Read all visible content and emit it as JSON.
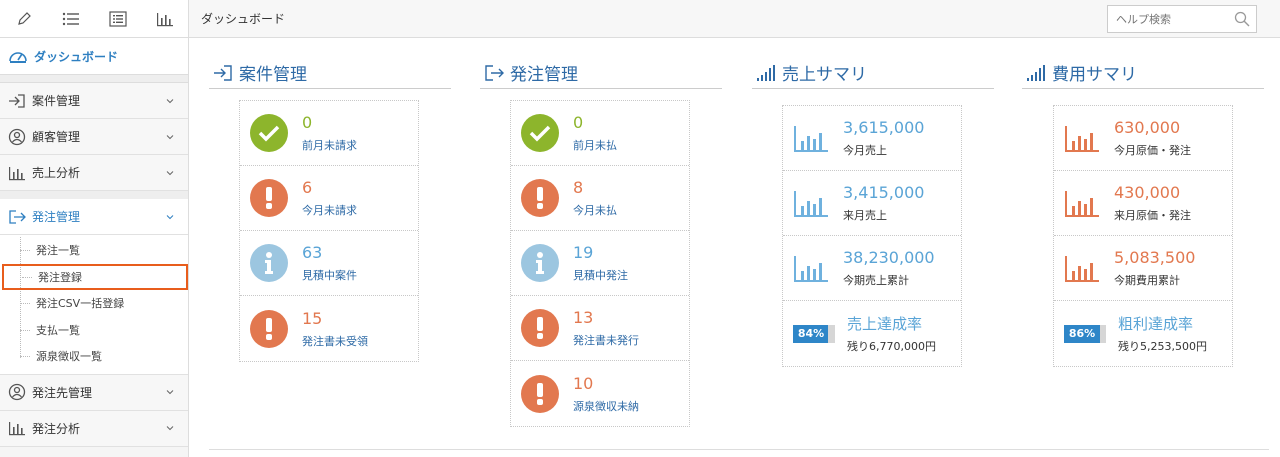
{
  "topbar": {
    "breadcrumb": "ダッシュボード",
    "search_placeholder": "ヘルプ検索"
  },
  "sidebar": {
    "brand": "ダッシュボード",
    "items": [
      {
        "label": "案件管理"
      },
      {
        "label": "顧客管理"
      },
      {
        "label": "売上分析"
      },
      {
        "label": "発注管理"
      },
      {
        "label": "発注先管理"
      },
      {
        "label": "発注分析"
      }
    ],
    "sub_items": [
      {
        "label": "発注一覧"
      },
      {
        "label": "発注登録"
      },
      {
        "label": "発注CSV一括登録"
      },
      {
        "label": "支払一覧"
      },
      {
        "label": "源泉徴収一覧"
      }
    ]
  },
  "sections": {
    "anken": {
      "title": "案件管理",
      "rows": [
        {
          "value": "0",
          "label": "前月未請求"
        },
        {
          "value": "6",
          "label": "今月未請求"
        },
        {
          "value": "63",
          "label": "見積中案件"
        },
        {
          "value": "15",
          "label": "発注書未受領"
        }
      ]
    },
    "hatchu": {
      "title": "発注管理",
      "rows": [
        {
          "value": "0",
          "label": "前月未払"
        },
        {
          "value": "8",
          "label": "今月未払"
        },
        {
          "value": "19",
          "label": "見積中発注"
        },
        {
          "value": "13",
          "label": "発注書未発行"
        },
        {
          "value": "10",
          "label": "源泉徴収未納"
        }
      ]
    },
    "uriage": {
      "title": "売上サマリ",
      "rows": [
        {
          "value": "3,615,000",
          "label": "今月売上"
        },
        {
          "value": "3,415,000",
          "label": "来月売上"
        },
        {
          "value": "38,230,000",
          "label": "今期売上累計"
        }
      ],
      "rate": {
        "percent_text": "84%",
        "percent": 84,
        "title": "売上達成率",
        "remaining": "残り6,770,000円"
      }
    },
    "hiyou": {
      "title": "費用サマリ",
      "rows": [
        {
          "value": "630,000",
          "label": "今月原価・発注"
        },
        {
          "value": "430,000",
          "label": "来月原価・発注"
        },
        {
          "value": "5,083,500",
          "label": "今期費用累計"
        }
      ],
      "rate": {
        "percent_text": "86%",
        "percent": 86,
        "title": "粗利達成率",
        "remaining": "残り5,253,500円"
      }
    }
  },
  "colors": {
    "accent": "#2e6aa6",
    "green": "#8db52c",
    "orange": "#e2784f",
    "light_blue": "#9cc6e0",
    "highlight": "#e85d1c"
  }
}
